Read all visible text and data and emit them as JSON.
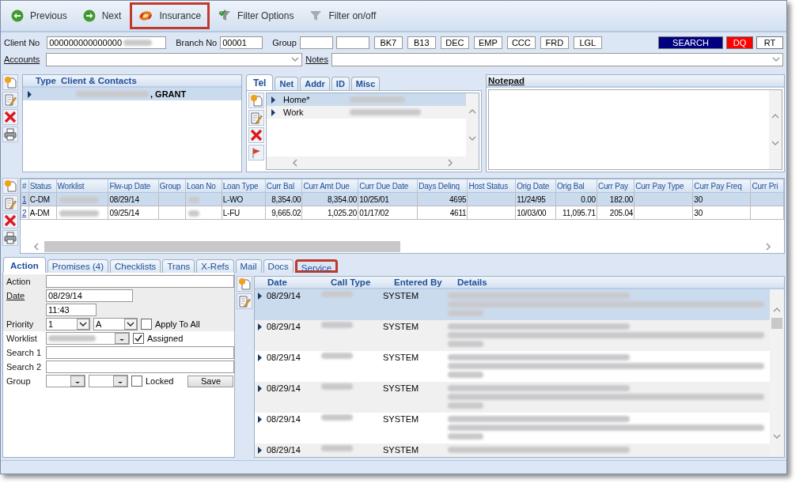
{
  "toolbar": [
    {
      "kind": "back",
      "label": "Previous",
      "highlighted": false
    },
    {
      "kind": "forward",
      "label": "Next",
      "highlighted": false
    },
    {
      "kind": "insurance",
      "label": "Insurance",
      "highlighted": true
    },
    {
      "kind": "filter-options",
      "label": "Filter Options",
      "highlighted": false
    },
    {
      "kind": "filter-toggle",
      "label": "Filter on/off",
      "highlighted": false
    }
  ],
  "client_bar": {
    "client_no": {
      "label": "Client No",
      "value": "000000000000000"
    },
    "branch_no": {
      "label": "Branch No",
      "value": "00001"
    },
    "group": {
      "label": "Group"
    },
    "codes": [
      "BK7",
      "B13",
      "DEC",
      "EMP",
      "CCC",
      "FRD",
      "LGL"
    ],
    "actions": [
      {
        "label": "SEARCH",
        "color": "#000080"
      },
      {
        "label": "DQ",
        "color": "#ff0000"
      },
      {
        "label": "RT",
        "color": "#ffffff"
      }
    ]
  },
  "accounts": {
    "label": "Accounts"
  },
  "notes": {
    "label": "Notes"
  },
  "contacts": {
    "columns": [
      "Type",
      "Client & Contacts"
    ],
    "rows": [
      {
        "name": ", GRANT",
        "selected": true
      }
    ]
  },
  "phone_tabs": [
    {
      "label": "Tel",
      "selected": true
    },
    {
      "label": "Net",
      "selected": false
    },
    {
      "label": "Addr",
      "selected": false
    },
    {
      "label": "ID",
      "selected": false
    },
    {
      "label": "Misc",
      "selected": false
    }
  ],
  "phones": [
    {
      "type": "Home*",
      "selected": true
    },
    {
      "type": "Work",
      "selected": false
    }
  ],
  "notepad": {
    "title": "Notepad"
  },
  "loans": {
    "columns": [
      "#",
      "Status",
      "Worklist",
      "Flw-up Date",
      "Group",
      "Loan No",
      "Loan Type",
      "Curr Bal",
      "Curr Amt Due",
      "Curr Due Date",
      "Days Delinq",
      "Host Status",
      "Orig Date",
      "Orig Bal",
      "Curr Pay",
      "Curr Pay Type",
      "Curr Pay Freq",
      "Curr Pri"
    ],
    "rows": [
      {
        "selected": true,
        "cells": [
          "1",
          "C-DM",
          null,
          "08/29/14",
          "",
          null,
          "L-WO",
          "8,354.00",
          "8,354.00",
          "10/25/01",
          "4695",
          "",
          "11/24/95",
          "0.00",
          "182.00",
          "",
          "30"
        ]
      },
      {
        "selected": false,
        "cells": [
          "2",
          "A-DM",
          null,
          "09/25/14",
          "",
          null,
          "L-FU",
          "9,665.02",
          "1,025.20",
          "01/17/02",
          "4611",
          "",
          "10/03/00",
          "11,095.71",
          "205.04",
          "",
          "30"
        ]
      }
    ]
  },
  "tabs": [
    {
      "label": "Action",
      "selected": true,
      "highlighted": false
    },
    {
      "label": "Promises (4)",
      "selected": false,
      "highlighted": false
    },
    {
      "label": "Checklists",
      "selected": false,
      "highlighted": false
    },
    {
      "label": "Trans",
      "selected": false,
      "highlighted": false
    },
    {
      "label": "X-Refs",
      "selected": false,
      "highlighted": false
    },
    {
      "label": "Mail",
      "selected": false,
      "highlighted": false
    },
    {
      "label": "Docs",
      "selected": false,
      "highlighted": false
    },
    {
      "label": "Service",
      "selected": false,
      "highlighted": true
    }
  ],
  "action_form": {
    "action_label": "Action",
    "date_label": "Date",
    "date": "08/29/14",
    "time": "11:43",
    "priority_label": "Priority",
    "priority": "1",
    "priority_class": "A",
    "apply_to_all": {
      "label": "Apply To All",
      "checked": false
    },
    "worklist_label": "Worklist",
    "assigned": {
      "label": "Assigned",
      "checked": true
    },
    "search1_label": "Search 1",
    "search2_label": "Search 2",
    "group_label": "Group",
    "locked": {
      "label": "Locked",
      "checked": false
    },
    "save": "Save"
  },
  "history": {
    "columns": [
      "Date",
      "Call Type",
      "Entered By",
      "Details"
    ],
    "rows": [
      {
        "date": "08/29/14",
        "entered_by": "SYSTEM",
        "selected": true
      },
      {
        "date": "08/29/14",
        "entered_by": "SYSTEM",
        "selected": false
      },
      {
        "date": "08/29/14",
        "entered_by": "SYSTEM",
        "selected": false
      },
      {
        "date": "08/29/14",
        "entered_by": "SYSTEM",
        "selected": false
      },
      {
        "date": "08/29/14",
        "entered_by": "SYSTEM",
        "selected": false
      },
      {
        "date": "08/29/14",
        "entered_by": "SYSTEM",
        "selected": false
      }
    ]
  }
}
